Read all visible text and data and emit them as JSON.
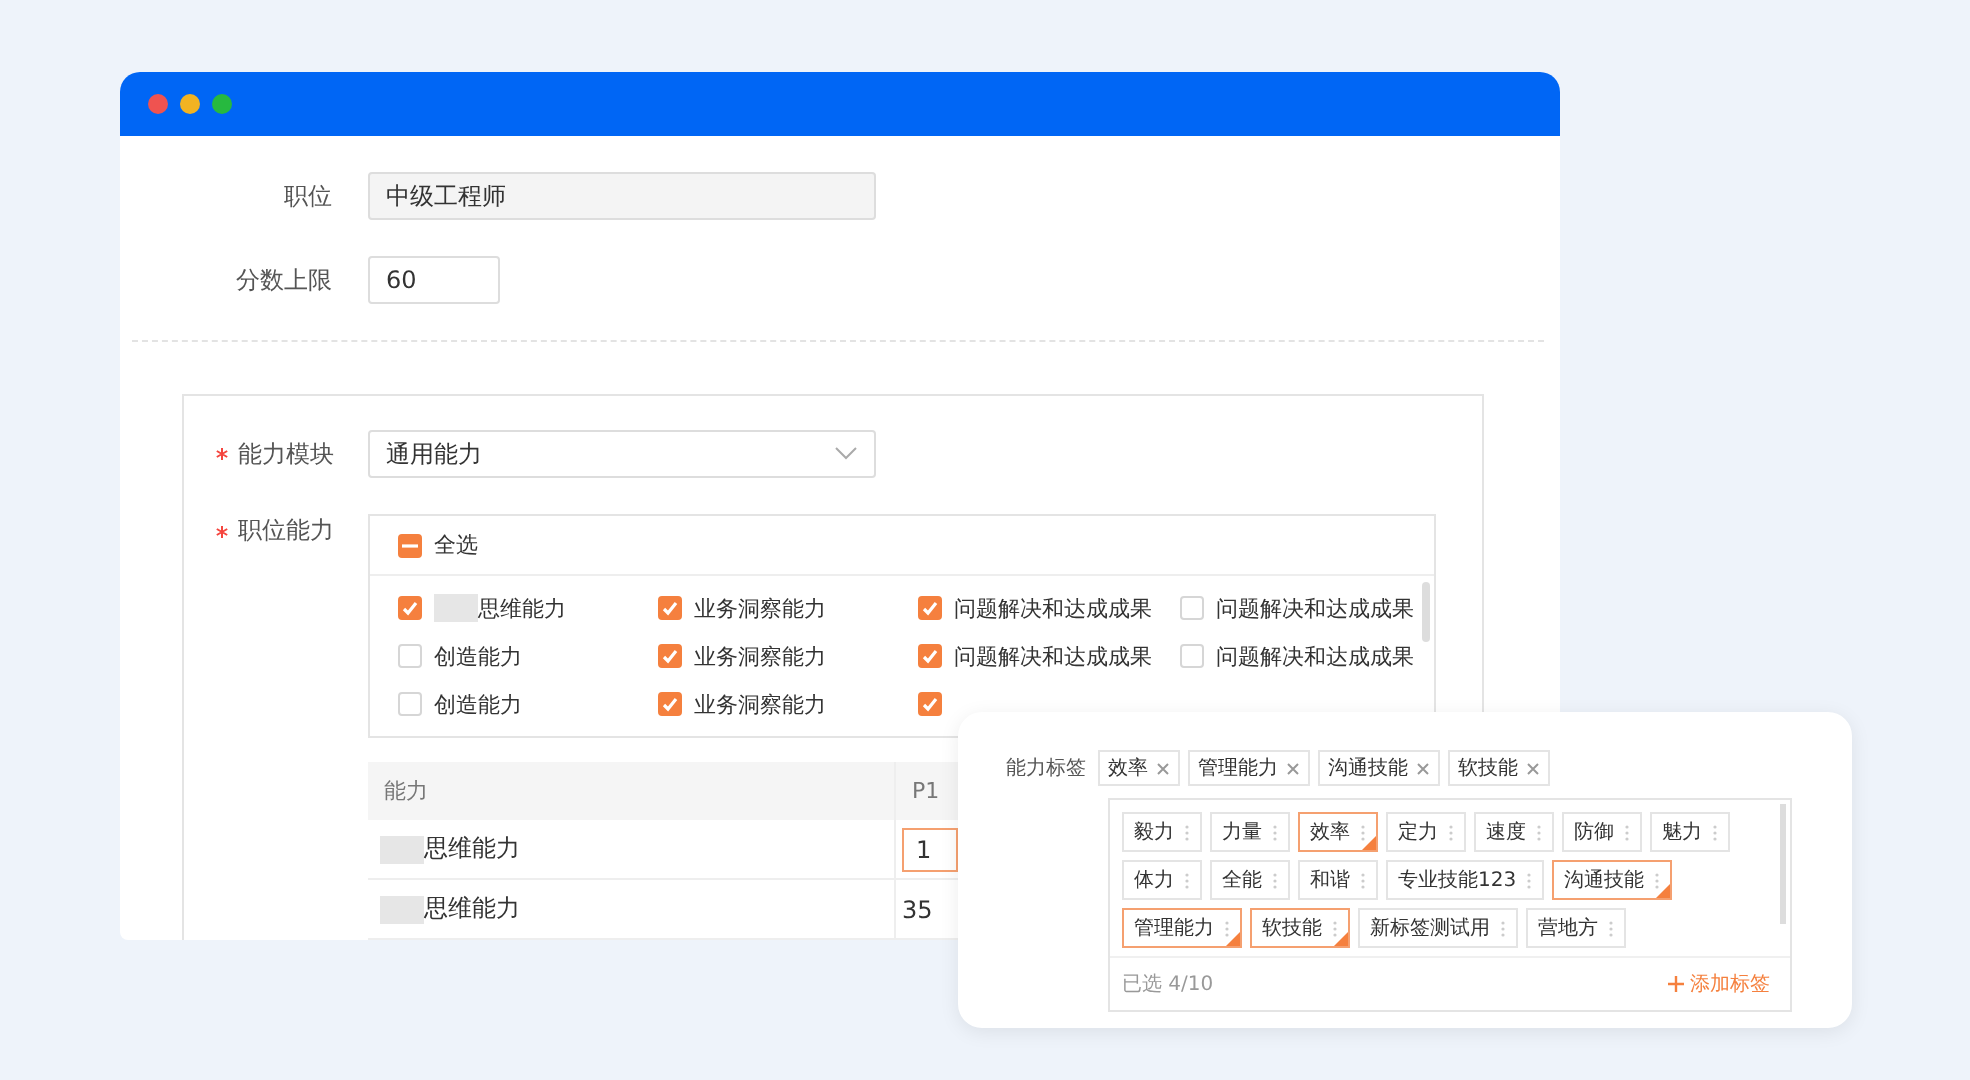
{
  "form": {
    "position": {
      "label": "职位",
      "value": "中级工程师"
    },
    "score_limit": {
      "label": "分数上限",
      "value": "60"
    },
    "module": {
      "label": "能力模块",
      "required": true,
      "value": "通用能力"
    },
    "abilities": {
      "label": "职位能力",
      "required": true,
      "select_all": {
        "label": "全选",
        "indeterminate": true
      },
      "items": [
        {
          "label": "思维能力",
          "checked": true,
          "blurred": true
        },
        {
          "label": "业务洞察能力",
          "checked": true,
          "blurred": false
        },
        {
          "label": "问题解决和达成成果",
          "checked": true,
          "blurred": false
        },
        {
          "label": "问题解决和达成成果",
          "checked": false,
          "blurred": false
        },
        {
          "label": "创造能力",
          "checked": false,
          "blurred": false
        },
        {
          "label": "业务洞察能力",
          "checked": true,
          "blurred": false
        },
        {
          "label": "问题解决和达成成果",
          "checked": true,
          "blurred": false
        },
        {
          "label": "问题解决和达成成果",
          "checked": false,
          "blurred": false
        },
        {
          "label": "创造能力",
          "checked": false,
          "blurred": false
        },
        {
          "label": "业务洞察能力",
          "checked": true,
          "blurred": false
        },
        {
          "checked": true,
          "blurred": false
        }
      ]
    }
  },
  "table": {
    "columns": [
      "能力",
      "P1"
    ],
    "rows": [
      {
        "ability": "思维能力",
        "blurred": true,
        "p1": "1",
        "editing": true
      },
      {
        "ability": "思维能力",
        "blurred": true,
        "p1": "35",
        "editing": false
      }
    ]
  },
  "tag_popup": {
    "label": "能力标签",
    "selected_tags": [
      {
        "label": "效率"
      },
      {
        "label": "管理能力"
      },
      {
        "label": "沟通技能"
      },
      {
        "label": "软技能"
      }
    ],
    "tags": [
      {
        "label": "毅力",
        "selected": false
      },
      {
        "label": "力量",
        "selected": false
      },
      {
        "label": "效率",
        "selected": true
      },
      {
        "label": "定力",
        "selected": false
      },
      {
        "label": "速度",
        "selected": false
      },
      {
        "label": "防御",
        "selected": false
      },
      {
        "label": "魅力",
        "selected": false
      },
      {
        "label": "体力",
        "selected": false
      },
      {
        "label": "全能",
        "selected": false
      },
      {
        "label": "和谐",
        "selected": false
      },
      {
        "label": "专业技能123",
        "selected": false
      },
      {
        "label": "沟通技能",
        "selected": true
      },
      {
        "label": "管理能力",
        "selected": true
      },
      {
        "label": "软技能",
        "selected": true
      },
      {
        "label": "新标签测试用",
        "selected": false
      },
      {
        "label": "营地方",
        "selected": false
      }
    ],
    "count": "已选 4/10",
    "add_label": "添加标签"
  }
}
